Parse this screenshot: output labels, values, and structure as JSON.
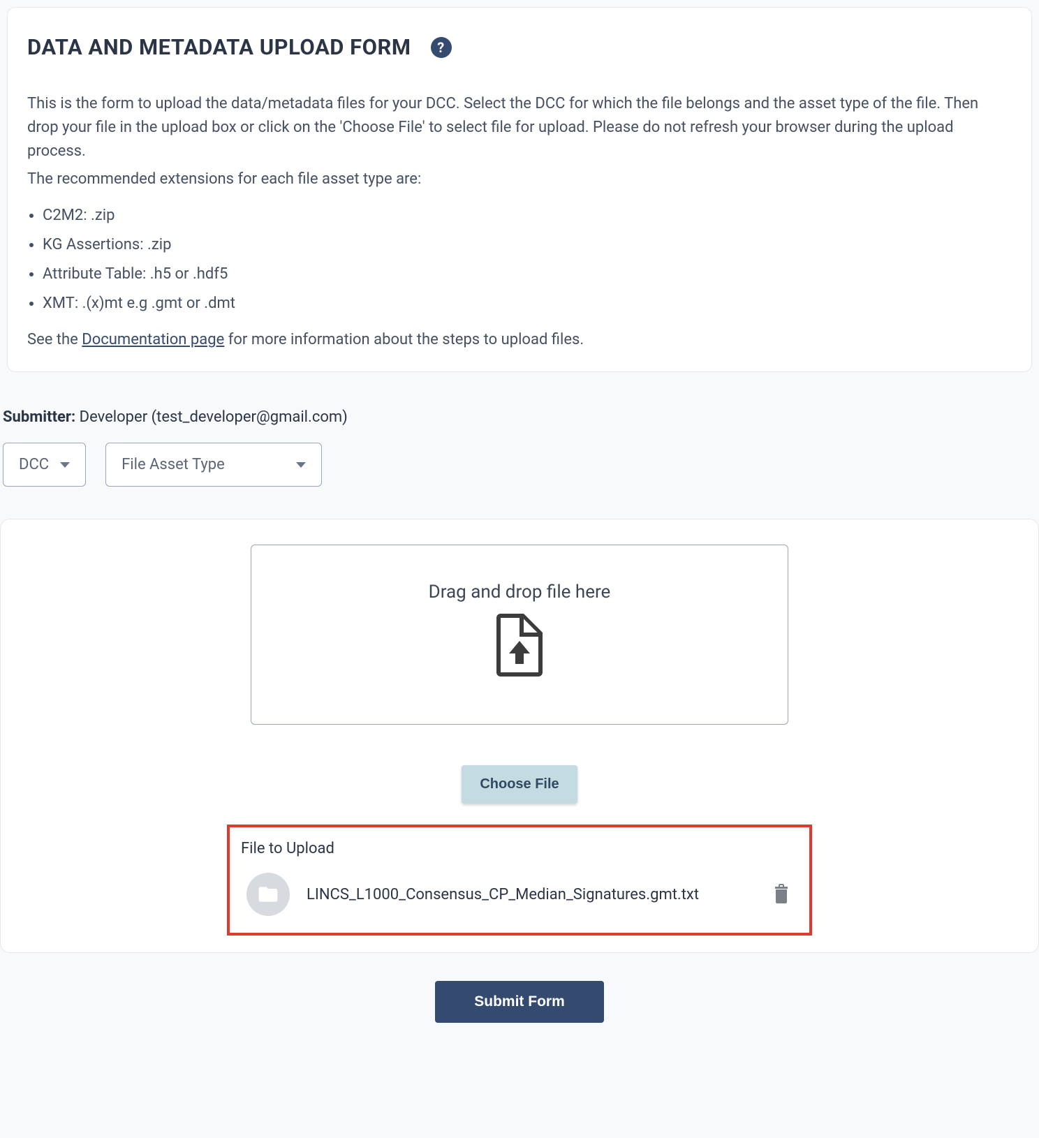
{
  "header": {
    "title": "DATA AND METADATA UPLOAD FORM"
  },
  "intro": {
    "paragraph": "This is the form to upload the data/metadata files for your DCC. Select the DCC for which the file belongs and the asset type of the file. Then drop your file in the upload box or click on the 'Choose File' to select file for upload. Please do not refresh your browser during the upload process.",
    "recommended_line": "The recommended extensions for each file asset type are:",
    "extensions": [
      "C2M2: .zip",
      "KG Assertions: .zip",
      "Attribute Table: .h5 or .hdf5",
      "XMT: .(x)mt e.g .gmt or .dmt"
    ],
    "doc_prefix": "See the ",
    "doc_link_text": "Documentation page",
    "doc_suffix": " for more information about the steps to upload files."
  },
  "submitter": {
    "label": "Submitter:",
    "value": "Developer (test_developer@gmail.com)"
  },
  "selects": {
    "dcc_label": "DCC",
    "asset_type_label": "File Asset Type"
  },
  "dropzone": {
    "text": "Drag and drop file here"
  },
  "choose_file_label": "Choose File",
  "file_panel": {
    "title": "File to Upload",
    "file_name": "LINCS_L1000_Consensus_CP_Median_Signatures.gmt.txt"
  },
  "submit_label": "Submit Form"
}
